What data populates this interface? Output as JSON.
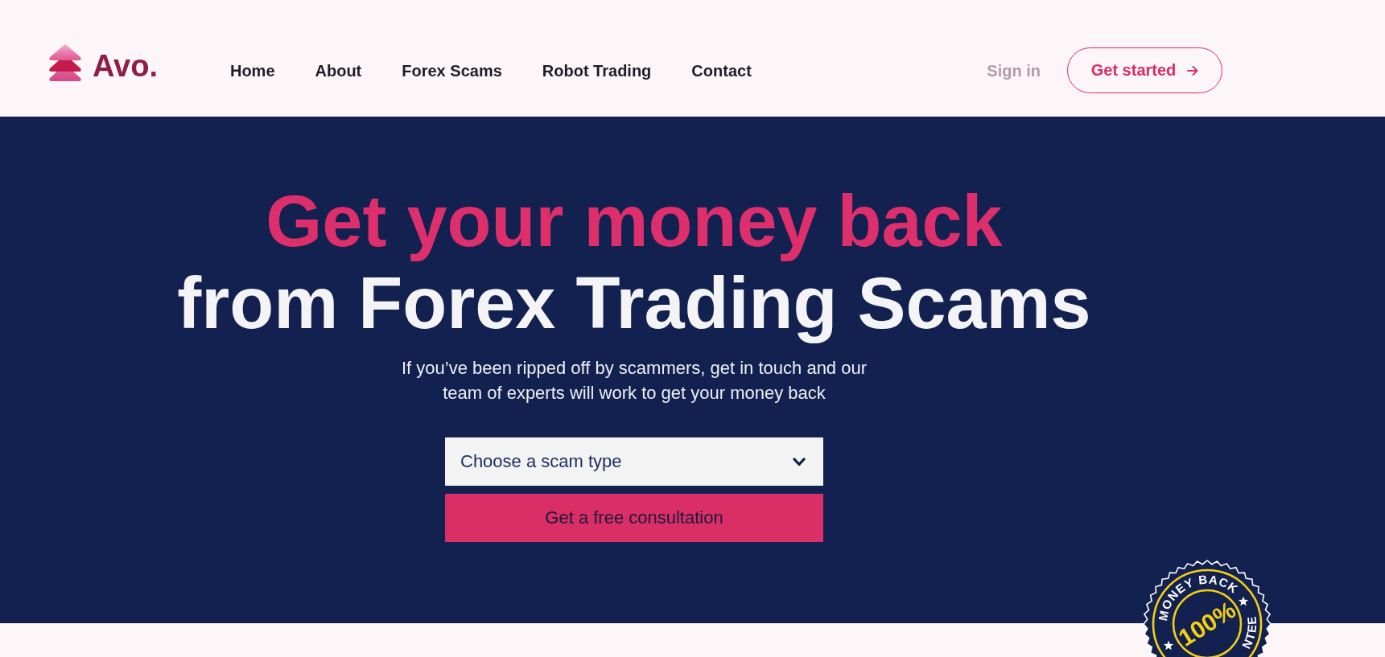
{
  "header": {
    "logo": "Avo.",
    "nav": [
      "Home",
      "About",
      "Forex Scams",
      "Robot Trading",
      "Contact"
    ],
    "sign_in": "Sign in",
    "get_started": "Get started"
  },
  "hero": {
    "headline": [
      {
        "text": "Get your money back",
        "kind": "accent"
      },
      {
        "text": "from Forex Trading Scams",
        "kind": "plain"
      }
    ],
    "subtitle": "If you’ve been ripped off by scammers, get in touch and our team of experts will work to get your money back",
    "scam_select": {
      "placeholder": "Choose a scam type"
    },
    "consult_button": "Get a free consultation",
    "seal": {
      "top_text": "MONEY BACK",
      "center_text": "100%",
      "bottom_text": "NTEE"
    }
  }
}
